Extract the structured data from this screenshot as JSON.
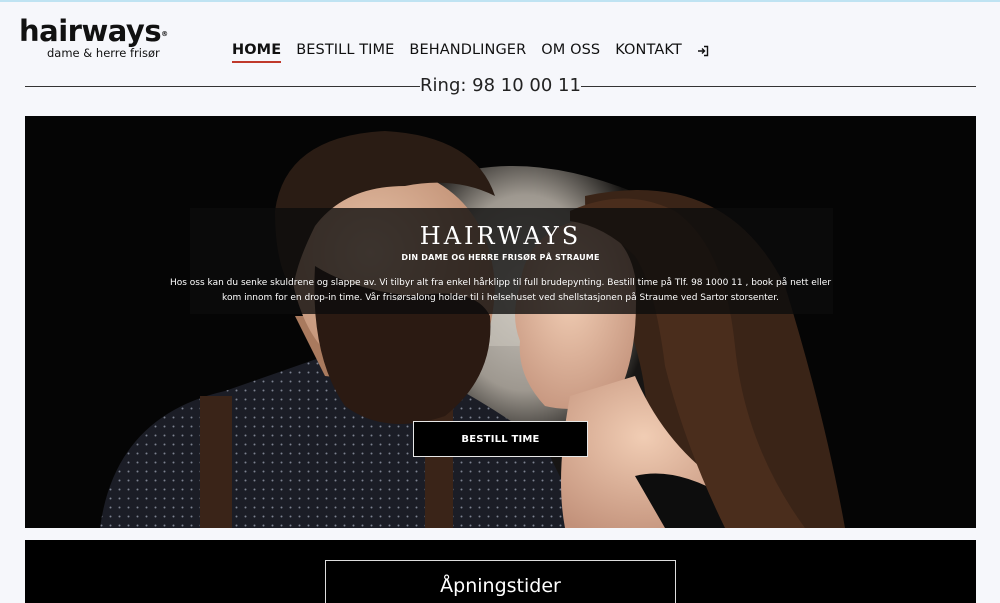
{
  "logo": {
    "word": "hairways",
    "reg": "®",
    "tagline": "dame & herre frisør"
  },
  "nav": {
    "items": [
      {
        "label": "HOME"
      },
      {
        "label": "BESTILL TIME"
      },
      {
        "label": "BEHANDLINGER"
      },
      {
        "label": "OM OSS"
      },
      {
        "label": "KONTAKT"
      }
    ],
    "login_icon": "login-icon"
  },
  "ring": "Ring: 98 10 00 11",
  "hero": {
    "title": "HAIRWAYS",
    "subtitle": "DIN DAME OG HERRE FRISØR PÅ STRAUME",
    "description": "Hos oss kan du senke skuldrene og slappe av. Vi tilbyr alt fra enkel hårklipp til full brudepynting. Bestill time på Tlf. 98 1000 11 , book på nett eller kom innom for en drop-in time. Vår frisørsalong holder til i helsehuset ved shellstasjonen på Straume ved Sartor storsenter.",
    "button": "BESTILL TIME"
  },
  "hours": {
    "title": "Åpningstider"
  },
  "colors": {
    "accent_underline": "#c0392b",
    "page_bg": "#f6f7fb",
    "hero_bg": "#050505"
  }
}
